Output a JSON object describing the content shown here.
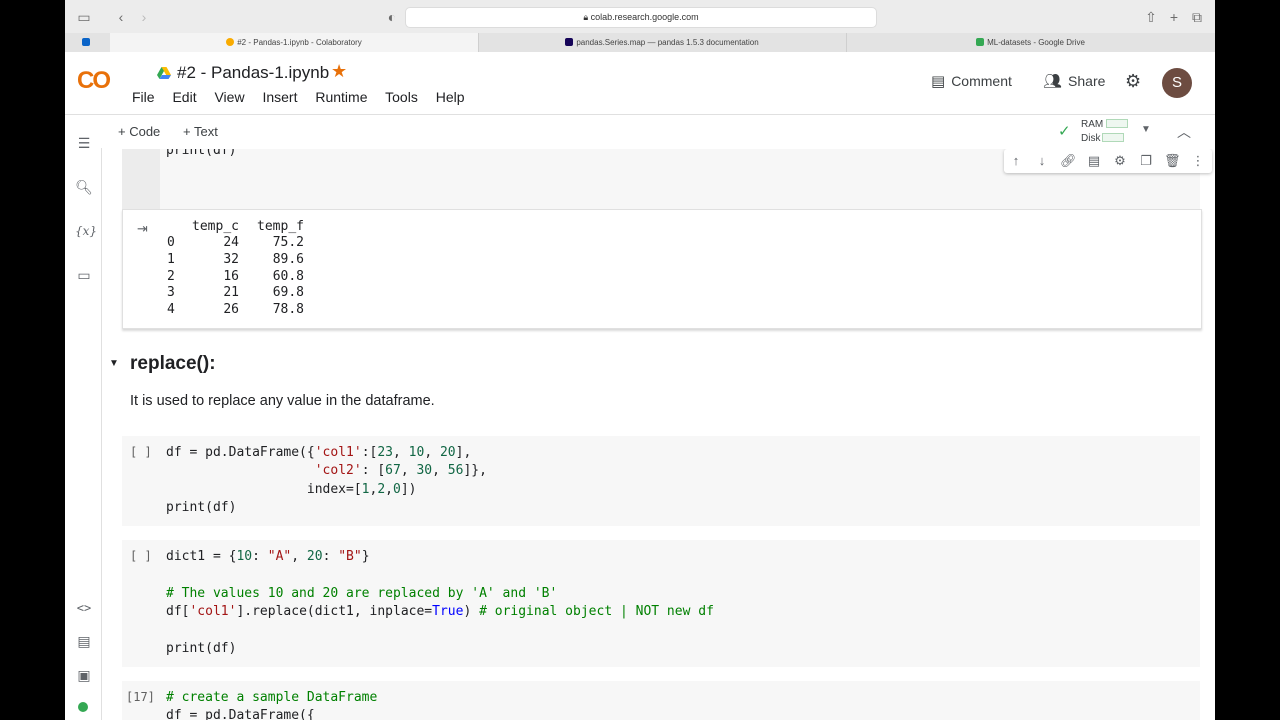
{
  "browser": {
    "url": "colab.research.google.com",
    "tabs": [
      {
        "title": "#2 - Pandas-1.ipynb - Colaboratory",
        "active": true
      },
      {
        "title": "pandas.Series.map — pandas 1.5.3 documentation",
        "active": false
      },
      {
        "title": "ML-datasets - Google Drive",
        "active": false
      }
    ]
  },
  "header": {
    "logo": "CO",
    "notebook_title": "#2 - Pandas-1.ipynb",
    "menu": [
      "File",
      "Edit",
      "View",
      "Insert",
      "Runtime",
      "Tools",
      "Help"
    ],
    "comment_label": "Comment",
    "share_label": "Share",
    "avatar_letter": "S"
  },
  "toolbar": {
    "code_label": "+ Code",
    "text_label": "+ Text",
    "ram_label": "RAM",
    "disk_label": "Disk"
  },
  "cell1": {
    "code": "print(df)",
    "output": {
      "columns": [
        "",
        "temp_c",
        "temp_f"
      ],
      "rows": [
        [
          "0",
          "24",
          "75.2"
        ],
        [
          "1",
          "32",
          "89.6"
        ],
        [
          "2",
          "16",
          "60.8"
        ],
        [
          "3",
          "21",
          "69.8"
        ],
        [
          "4",
          "26",
          "78.8"
        ]
      ]
    }
  },
  "section": {
    "heading": "replace():",
    "description": "It is used to replace any value in the dataframe."
  },
  "cell2": {
    "run_label": "[ ]",
    "lines": [
      "df = pd.DataFrame({'col1':[23, 10, 20],",
      "                   'col2': [67, 30, 56]},",
      "                  index=[1,2,0])",
      "print(df)"
    ]
  },
  "cell3": {
    "run_label": "[ ]",
    "lines": [
      "dict1 = {10: \"A\", 20: \"B\"}",
      "",
      "# The values 10 and 20 are replaced by 'A' and 'B'",
      "df['col1'].replace(dict1, inplace=True) # original object | NOT new df",
      "",
      "print(df)"
    ]
  },
  "cell4": {
    "run_label": "[17]",
    "lines": [
      "# create a sample DataFrame",
      "df = pd.DataFrame({"
    ]
  }
}
